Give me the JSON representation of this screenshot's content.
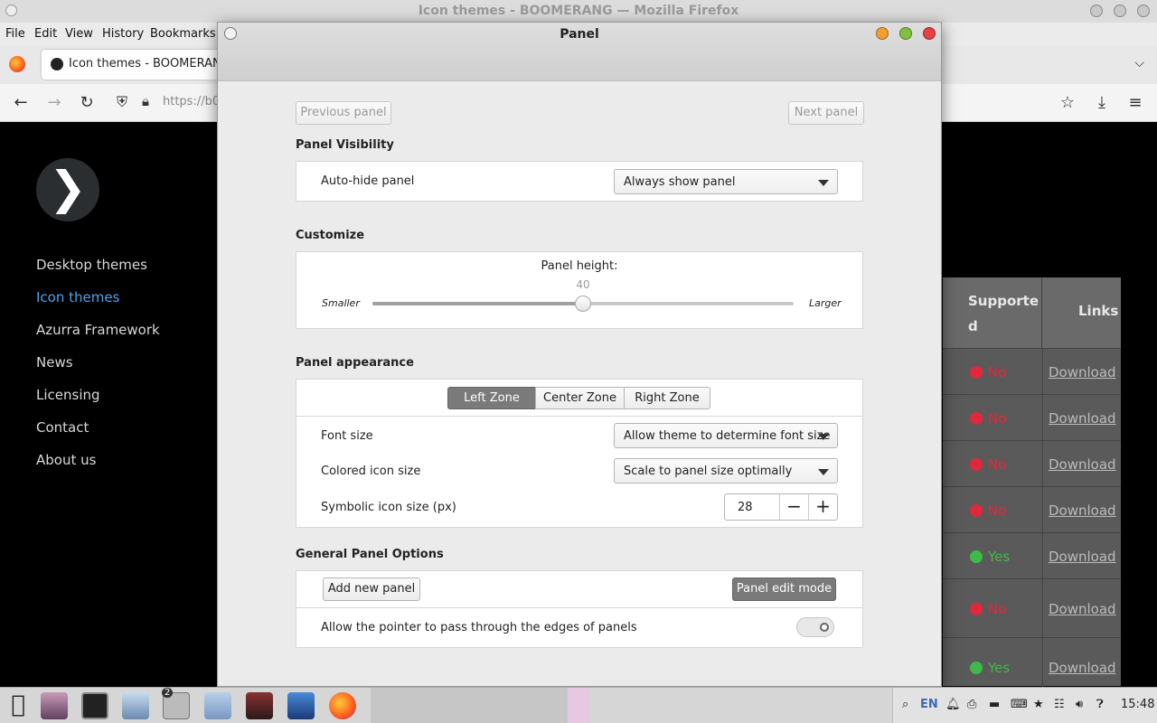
{
  "firefox": {
    "window_title": "Icon themes - BOOMERANG — Mozilla Firefox",
    "menu": [
      "File",
      "Edit",
      "View",
      "History",
      "Bookmarks"
    ],
    "tab_title": "Icon themes - BOOMERANG",
    "url_partial": "https://b0"
  },
  "site": {
    "logo_glyph": "❯",
    "nav": [
      "Desktop themes",
      "Icon themes",
      "Azurra Framework",
      "News",
      "Licensing",
      "Contact",
      "About us"
    ],
    "active_nav": "Icon themes",
    "table": {
      "col_supported": "Supporte\nd",
      "col_links": "Links",
      "rows": [
        {
          "status": "No",
          "color": "#e0283c",
          "link": "Download"
        },
        {
          "status": "No",
          "color": "#e0283c",
          "link": "Download"
        },
        {
          "status": "No",
          "color": "#e0283c",
          "link": "Download"
        },
        {
          "status": "No",
          "color": "#e0283c",
          "link": "Download"
        },
        {
          "status": "Yes",
          "color": "#3fb94a",
          "link": "Download"
        },
        {
          "status": "No",
          "color": "#e0283c",
          "link": "Download"
        },
        {
          "status": "Yes",
          "color": "#3fb94a",
          "link": "Download"
        }
      ]
    }
  },
  "dialog": {
    "title": "Panel",
    "prev_button": "Previous panel",
    "next_button": "Next panel",
    "visibility": {
      "title": "Panel Visibility",
      "autohide_label": "Auto-hide panel",
      "autohide_value": "Always show panel"
    },
    "customize": {
      "title": "Customize",
      "height_label": "Panel height:",
      "height_value": "40",
      "height_fraction": 0.5,
      "smaller": "Smaller",
      "larger": "Larger"
    },
    "appearance": {
      "title": "Panel appearance",
      "zones": [
        "Left Zone",
        "Center Zone",
        "Right Zone"
      ],
      "active_zone": "Left Zone",
      "font_size_label": "Font size",
      "font_size_value": "Allow theme to determine font size",
      "colored_icon_label": "Colored icon size",
      "colored_icon_value": "Scale to panel size optimally",
      "symbolic_icon_label": "Symbolic icon size (px)",
      "symbolic_icon_value": "28",
      "minus": "−",
      "plus": "+"
    },
    "general": {
      "title": "General Panel Options",
      "add_panel": "Add new panel",
      "edit_mode": "Panel edit mode",
      "pointer_label": "Allow the pointer to pass through the edges of panels",
      "pointer_enabled": false
    }
  },
  "taskbar": {
    "lang": "EN",
    "clock": "15:48",
    "badge": "2"
  },
  "colors": {
    "accent_link": "#4da3e8",
    "close_button": "#e84040",
    "minimize_button": "#f0a030",
    "maximize_button": "#80c040"
  }
}
